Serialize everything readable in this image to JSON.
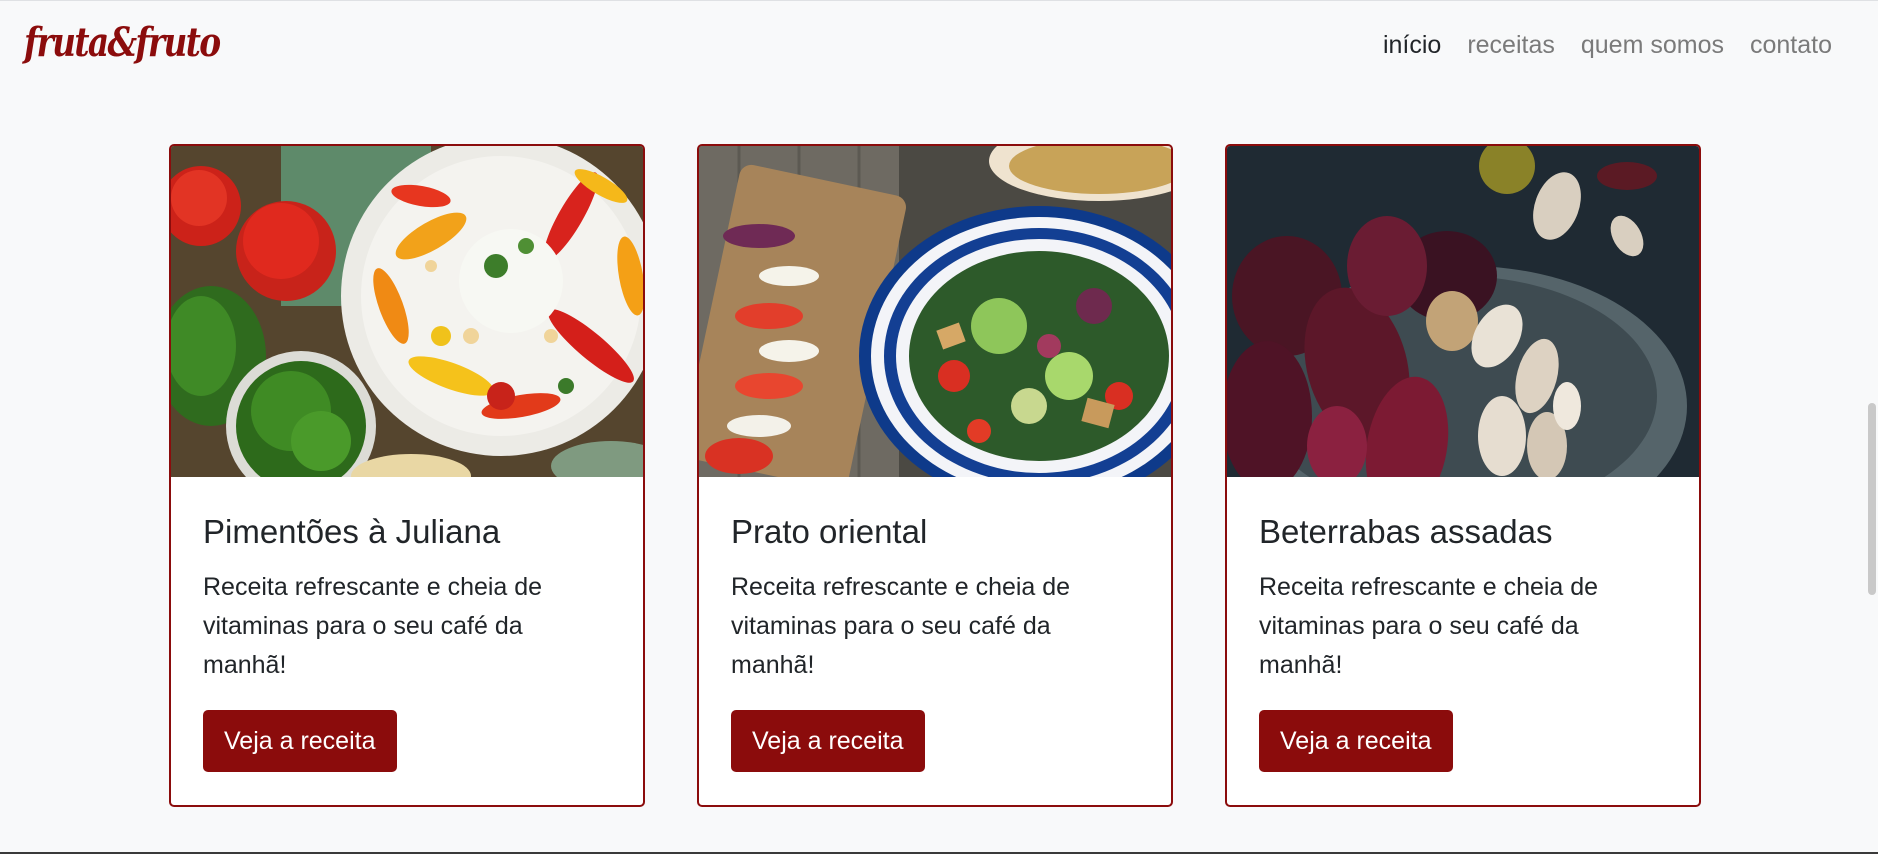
{
  "brand": "fruta&fruto",
  "nav": {
    "items": [
      {
        "label": "início",
        "active": true
      },
      {
        "label": "receitas",
        "active": false
      },
      {
        "label": "quem somos",
        "active": false
      },
      {
        "label": "contato",
        "active": false
      }
    ]
  },
  "cards": [
    {
      "title": "Pimentões à Juliana",
      "text": "Receita refrescante e cheia de vitaminas para o seu café da manhã!",
      "button": "Veja a receita"
    },
    {
      "title": "Prato oriental",
      "text": "Receita refrescante e cheia de vitaminas para o seu café da manhã!",
      "button": "Veja a receita"
    },
    {
      "title": "Beterrabas assadas",
      "text": "Receita refrescante e cheia de vitaminas para o seu café da manhã!",
      "button": "Veja a receita"
    }
  ],
  "colors": {
    "accent": "#8b0c0c",
    "background": "#f8f9fa",
    "nav_active": "#212529",
    "nav_inactive": "#7a7a7a"
  }
}
